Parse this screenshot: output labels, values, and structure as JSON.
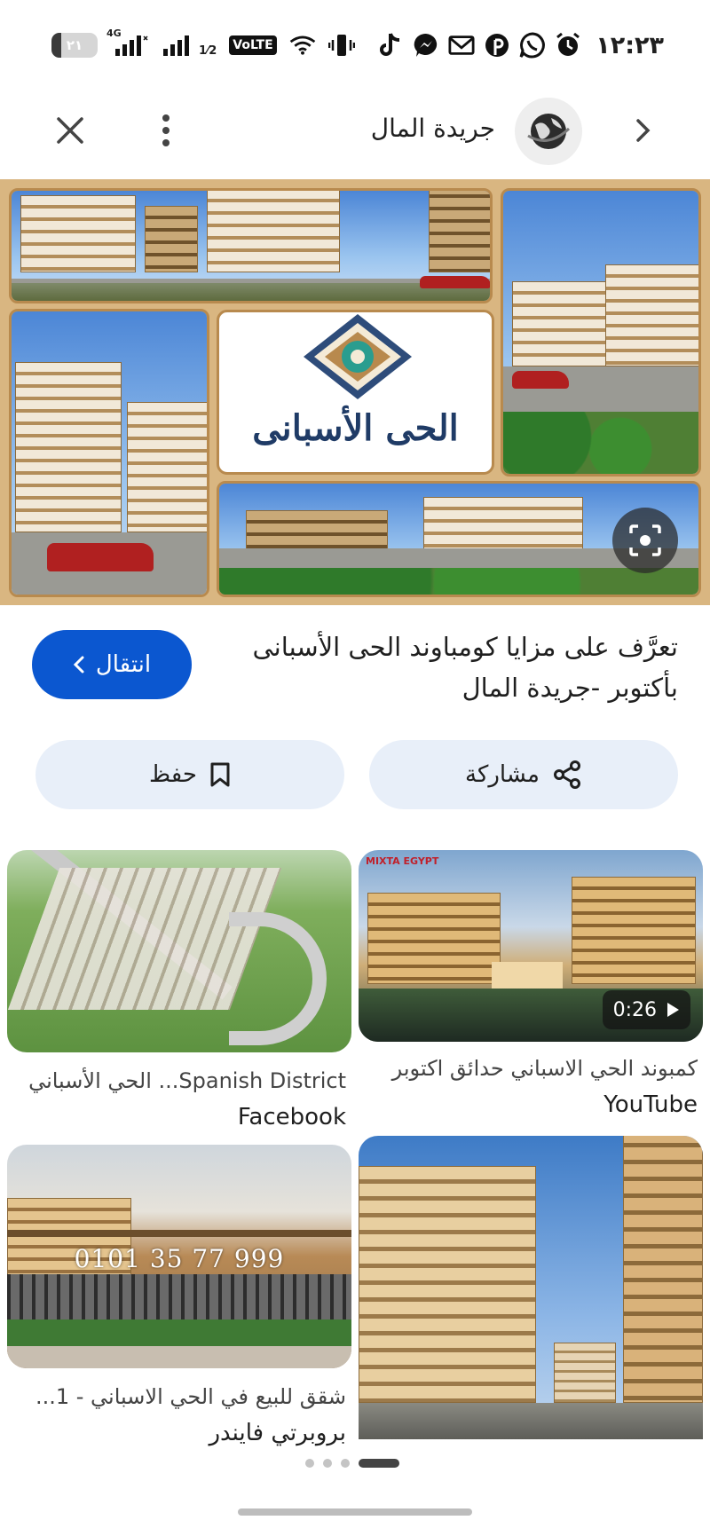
{
  "status_bar": {
    "time": "١٢:٢٣",
    "battery_level": "٢١",
    "network_type": "4G",
    "volte_label": "VoLTE",
    "sim2_tag": "1⁄2",
    "notification_icons": [
      "tiktok-icon",
      "messenger-icon",
      "gmail-icon",
      "pinterest-icon",
      "whatsapp-icon",
      "alarm-icon"
    ]
  },
  "topbar": {
    "source_name": "جريدة المال"
  },
  "hero": {
    "logo_text": "الحى الأسبانى"
  },
  "article": {
    "headline": "تعرَّف على مزايا كومباوند الحى الأسبانى بأكتوبر -جريدة المال",
    "visit_label": "انتقال"
  },
  "actions": {
    "save_label": "حفظ",
    "share_label": "مشاركة"
  },
  "related": [
    {
      "title": "كمبوند الحي الاسباني حدائق اكتوبر",
      "source": "YouTube",
      "duration": "0:26"
    },
    {
      "title": "Spanish District... الحي الأسباني",
      "source": "Facebook"
    },
    {
      "title": "شقق للبيع في الحي الاسباني - 1...",
      "source": "بروبرتي فايندر",
      "watermark": "0101 35 77 999"
    },
    {
      "title": "",
      "source": ""
    }
  ],
  "pager": {
    "page_count": 4,
    "active_index": 3
  },
  "colors": {
    "accent": "#0b57d0",
    "action_bg": "#e8eff9",
    "hero_frame": "#d9b681"
  }
}
